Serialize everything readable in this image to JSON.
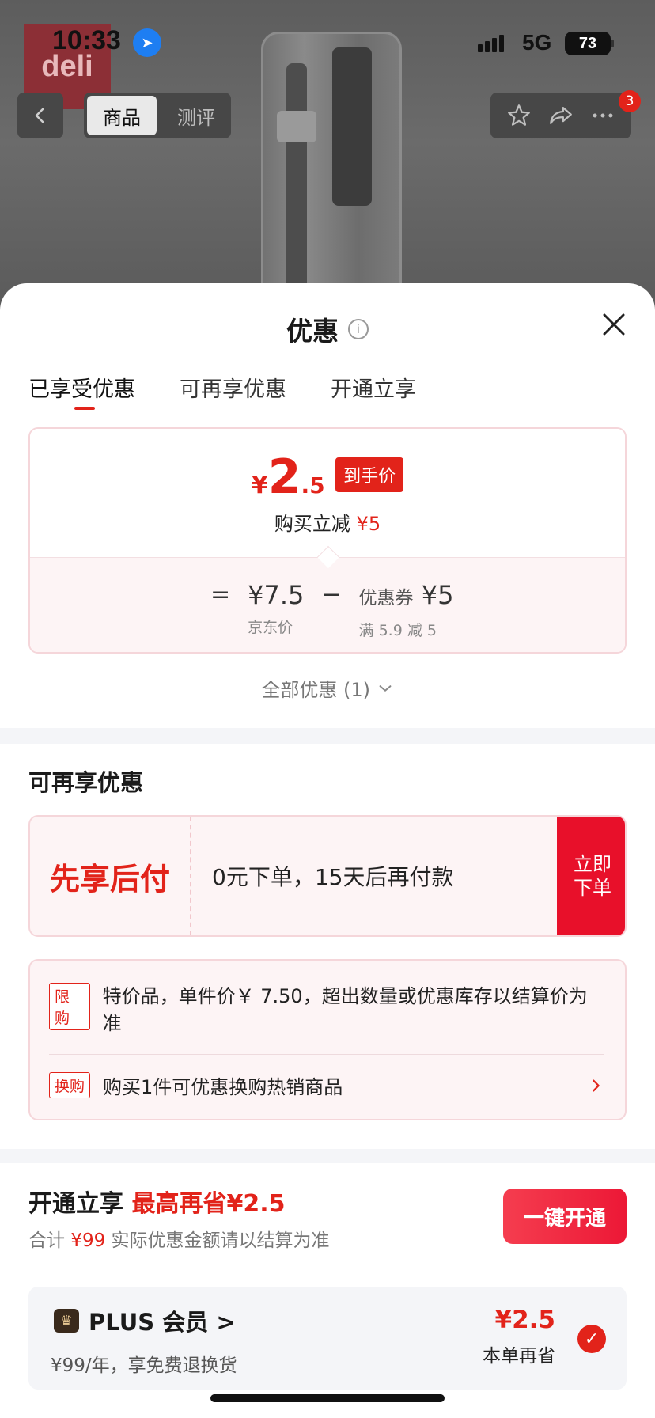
{
  "status_bar": {
    "time": "10:33",
    "network": "5G",
    "battery": "73"
  },
  "background": {
    "logo_text": "deli"
  },
  "nav": {
    "tabs": [
      "商品",
      "测评"
    ],
    "badge_count": "3"
  },
  "sheet": {
    "title": "优惠",
    "tabs": [
      "已享受优惠",
      "可再享优惠",
      "开通立享"
    ],
    "active_tab_index": 0,
    "price": {
      "currency": "¥",
      "integer": "2",
      "decimal": ".5",
      "tag": "到手价",
      "reduce_label": "购买立减",
      "reduce_amount": "¥5"
    },
    "formula": {
      "equals": "=",
      "jd_price": "¥7.5",
      "jd_price_label": "京东价",
      "minus": "−",
      "coupon_label": "优惠券",
      "coupon_amount": "¥5",
      "coupon_rule": "满 5.9 减 5"
    },
    "all_offers": "全部优惠 (1)"
  },
  "extra_offers": {
    "title": "可再享优惠",
    "bnpl": {
      "name": "先享后付",
      "description": "0元下单，15天后再付款",
      "button": "立即\n下单"
    },
    "limit": {
      "tag": "限购",
      "text": "特价品，单件价￥ 7.50，超出数量或优惠库存以结算价为准"
    },
    "exchange": {
      "tag": "换购",
      "text": "购买1件可优惠换购热销商品"
    }
  },
  "membership": {
    "title": "开通立享",
    "highlight": "最高再省¥2.5",
    "sub_prefix": "合计",
    "sub_amount": "¥99",
    "sub_suffix": "实际优惠金额请以结算为准",
    "button": "一键开通",
    "plus": {
      "name": "PLUS 会员 >",
      "desc": "¥99/年，享免费退换货",
      "save_amount": "¥2.5",
      "save_label": "本单再省"
    }
  },
  "colors": {
    "accent_red": "#e2231a",
    "card_pink": "#fdf4f5",
    "border_pink": "#f5d6da"
  }
}
